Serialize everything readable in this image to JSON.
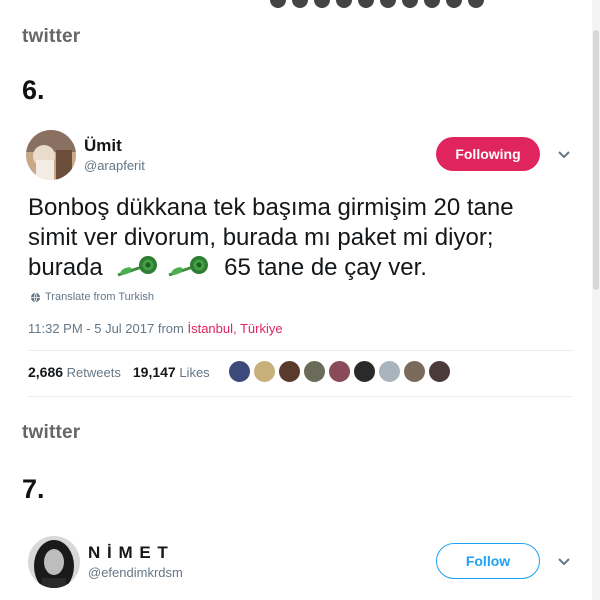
{
  "section1": {
    "source": "twitter",
    "number": "6."
  },
  "tweet1": {
    "author_name": "Ümit",
    "author_handle": "@arapferit",
    "follow_state": "Following",
    "text_lines": [
      "Bonboş dükkana tek başıma girmişim 20 tane",
      "simit ver divorum, burada mı paket mi diyor;",
      "burada",
      "65 tane de çay ver."
    ],
    "translate_label": "Translate from Turkish",
    "timestamp": "11:32 PM - 5 Jul 2017 from",
    "location": "İstanbul, Türkiye",
    "retweets_count": "2,686",
    "retweets_label": "Retweets",
    "likes_count": "19,147",
    "likes_label": "Likes",
    "liker_colors": [
      "#3b4a7a",
      "#c8b07a",
      "#5a3a2a",
      "#6b6b5a",
      "#8a4a5a",
      "#2a2a2a",
      "#aab4be",
      "#7a6a5a",
      "#4a3a3a"
    ],
    "accent_color": "#e0245e"
  },
  "section2": {
    "source": "twitter",
    "number": "7."
  },
  "tweet2": {
    "author_name": "N İ M E T",
    "author_handle": "@efendimkrdsm",
    "follow_state": "Follow",
    "accent_color": "#1da1f2"
  },
  "icons": [
    "globe-icon",
    "chevron-down-icon",
    "rose-emoji-icon"
  ]
}
